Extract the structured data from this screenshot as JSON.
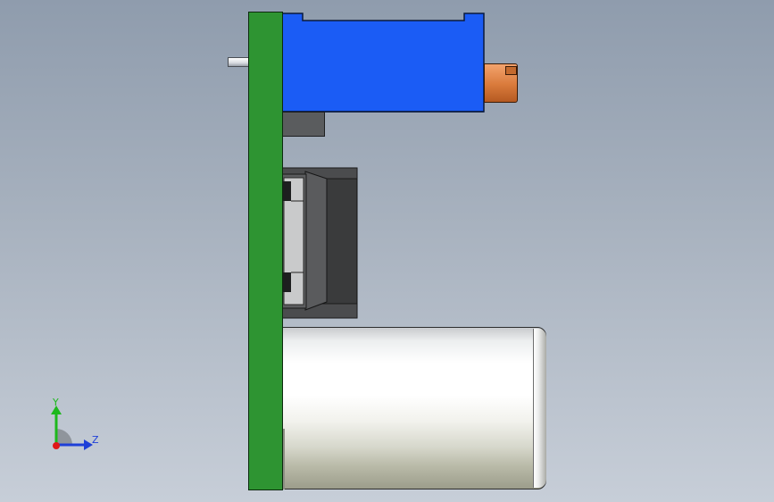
{
  "scene": {
    "background_top": "#8f9cad",
    "background_bottom": "#c7ced8"
  },
  "parts": {
    "pcb_color": "#2e9432",
    "relay_color": "#1b5cf5",
    "plug_color": "#d97a3b",
    "component_color": "#3a3b3c"
  },
  "triad": {
    "y_label": "Y",
    "z_label": "Z",
    "y_color": "#1db81d",
    "z_color": "#1e3fd8",
    "x_color": "#e01818"
  }
}
